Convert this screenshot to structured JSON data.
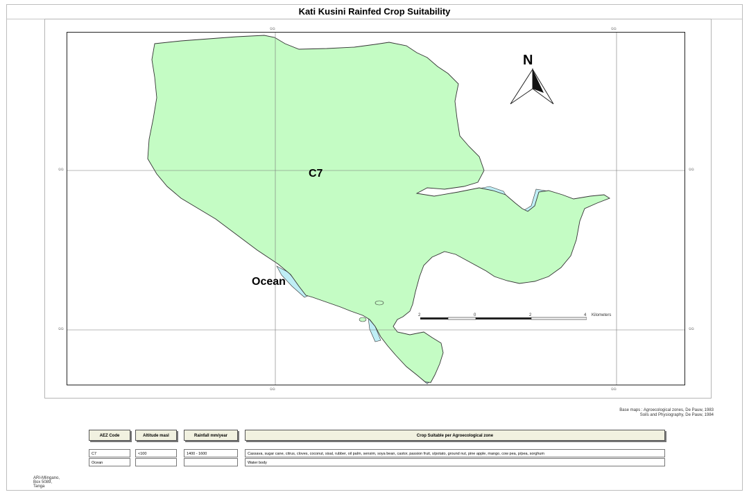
{
  "title": "Kati Kusini Rainfed Crop Suitability",
  "map": {
    "zone_label": "C7",
    "water_label": "Ocean",
    "north_letter": "N",
    "grid_tick_label": "ଭଭ",
    "scale": {
      "ticks": [
        "2",
        "0",
        "2",
        "4"
      ],
      "unit": "Kilometers"
    },
    "colors": {
      "land": "#c4fcc4",
      "water": "#bfeef5",
      "outline": "#333333"
    }
  },
  "sources": {
    "line1": "Base maps : Agroecological zones, De Pauw, 1983",
    "line2": "Soils and Physiography, De Pauw, 1984"
  },
  "legend": {
    "headers": [
      "AEZ Code",
      "Altitude masl",
      "Rainfall mm/year",
      "Crop Suitable per Agroecological zone"
    ],
    "rows": [
      {
        "code": "C7",
        "altitude": "<100",
        "rainfall": "1400 - 1600",
        "crops": "Cassava, sugar cane, citrus, cloves, coconut, sisal, rubber, oil palm, sensim, soya bean, castor, passion fruit, s/potato, ground nut, pine apple, mango, cow pea, p/pea, sorghum"
      },
      {
        "code": "Ocean",
        "altitude": "",
        "rainfall": "",
        "crops": "Water body"
      }
    ]
  },
  "address": {
    "line1": "ARI-Mlingano,",
    "line2": "Box 5089,",
    "line3": "Tanga"
  }
}
